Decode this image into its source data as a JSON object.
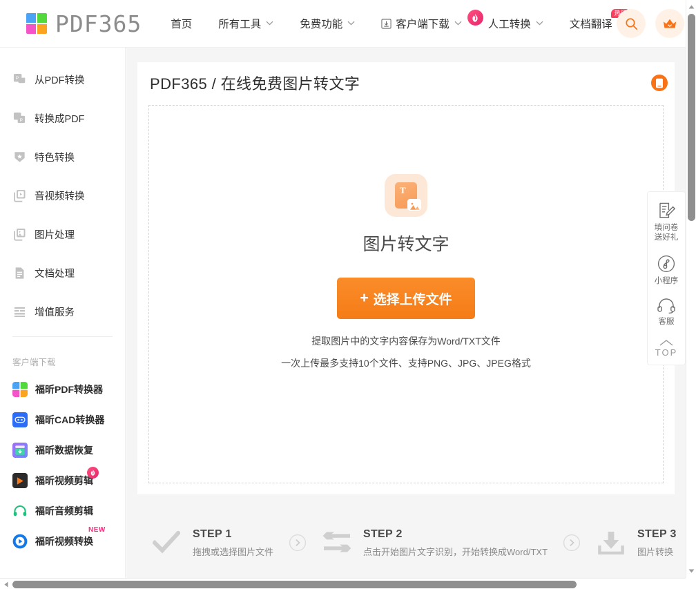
{
  "brand": {
    "name": "PDF365",
    "logo_colors": [
      "#4aa3f5",
      "#53d93b",
      "#f553c8",
      "#faa41f"
    ]
  },
  "nav": {
    "items": [
      {
        "label": "首页",
        "caret": "",
        "icon": "",
        "badge": ""
      },
      {
        "label": "所有工具",
        "caret": "⌄",
        "icon": "",
        "badge": ""
      },
      {
        "label": "免费功能",
        "caret": "⌄",
        "icon": "",
        "badge": ""
      },
      {
        "label": "客户端下载",
        "caret": "⌄",
        "icon": "download-box-icon",
        "badge": ""
      },
      {
        "label": "人工转换",
        "caret": "⌄",
        "icon": "flame-icon",
        "badge": ""
      },
      {
        "label": "文档翻译",
        "caret": "",
        "icon": "",
        "badge": "热门"
      }
    ],
    "search_icon": "search-icon",
    "vip_icon": "crown-icon"
  },
  "sidebar": {
    "items": [
      {
        "label": "从PDF转换",
        "icon": "pdf-from-icon"
      },
      {
        "label": "转换成PDF",
        "icon": "pdf-to-icon"
      },
      {
        "label": "特色转换",
        "icon": "shield-star-icon"
      },
      {
        "label": "音视频转换",
        "icon": "media-icon"
      },
      {
        "label": "图片处理",
        "icon": "image-icon"
      },
      {
        "label": "文档处理",
        "icon": "document-icon"
      },
      {
        "label": "增值服务",
        "icon": "list-icon"
      }
    ],
    "section_title": "客户端下载",
    "apps": [
      {
        "label": "福昕PDF转换器",
        "icon": "pdf365-app-icon",
        "badge": ""
      },
      {
        "label": "福昕CAD转换器",
        "icon": "cad-app-icon",
        "badge": ""
      },
      {
        "label": "福昕数据恢复",
        "icon": "data-recovery-app-icon",
        "badge": ""
      },
      {
        "label": "福昕视频剪辑",
        "icon": "video-editor-app-icon",
        "badge": "flame"
      },
      {
        "label": "福昕音频剪辑",
        "icon": "audio-editor-app-icon",
        "badge": ""
      },
      {
        "label": "福昕视频转换",
        "icon": "video-converter-app-icon",
        "badge": "NEW"
      }
    ]
  },
  "main": {
    "page_title": "PDF365 / 在线免费图片转文字",
    "mobile_icon": "mobile-phone-icon",
    "tool_icon": "image-to-text-icon",
    "tool_name": "图片转文字",
    "upload_button": {
      "plus": "+",
      "label": "选择上传文件",
      "color": "#f57c16"
    },
    "hint_line_1": "提取图片中的文字内容保存为Word/TXT文件",
    "hint_line_2": "一次上传最多支持10个文件、支持PNG、JPG、JPEG格式"
  },
  "steps": [
    {
      "title": "STEP 1",
      "desc": "拖拽或选择图片文件",
      "icon": "check-icon"
    },
    {
      "title": "STEP 2",
      "desc": "点击开始图片文字识别，开始转换成Word/TXT",
      "icon": "swap-arrows-icon"
    },
    {
      "title": "STEP 3",
      "desc": "图片转换",
      "icon": "download-icon"
    }
  ],
  "float_panel": {
    "items": [
      {
        "label": "填问卷\n送好礼",
        "icon": "survey-icon"
      },
      {
        "label": "小程序",
        "icon": "miniprogram-icon"
      },
      {
        "label": "客服",
        "icon": "headset-icon"
      }
    ],
    "top_label": "TOP",
    "top_icon": "chevron-up-icon"
  }
}
